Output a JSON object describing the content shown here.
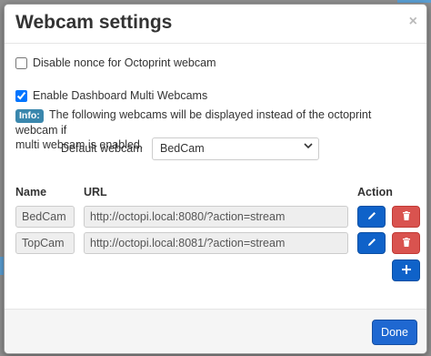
{
  "dialog": {
    "title": "Webcam settings",
    "close_glyph": "×"
  },
  "options": {
    "disable_nonce_label": "Disable nonce for Octoprint webcam",
    "disable_nonce_checked": false,
    "enable_multi_label": "Enable Dashboard Multi Webcams",
    "enable_multi_checked": true
  },
  "info": {
    "badge": "Info:",
    "text_line1": "The following webcams will be displayed instead of the octoprint webcam if",
    "text_line2": "multi webcam is enabled."
  },
  "default_webcam": {
    "label": "Default webcam",
    "selected": "BedCam"
  },
  "table": {
    "headers": {
      "name": "Name",
      "url": "URL",
      "action": "Action"
    },
    "rows": [
      {
        "name": "BedCam",
        "url": "http://octopi.local:8080/?action=stream"
      },
      {
        "name": "TopCam",
        "url": "http://octopi.local:8081/?action=stream"
      }
    ]
  },
  "icons": {
    "edit": "pencil-icon",
    "delete": "trash-icon",
    "add": "plus-icon"
  },
  "colors": {
    "primary": "#0f62c9",
    "danger": "#d9534f",
    "info_badge": "#3a87ad"
  },
  "footer": {
    "done_label": "Done"
  }
}
